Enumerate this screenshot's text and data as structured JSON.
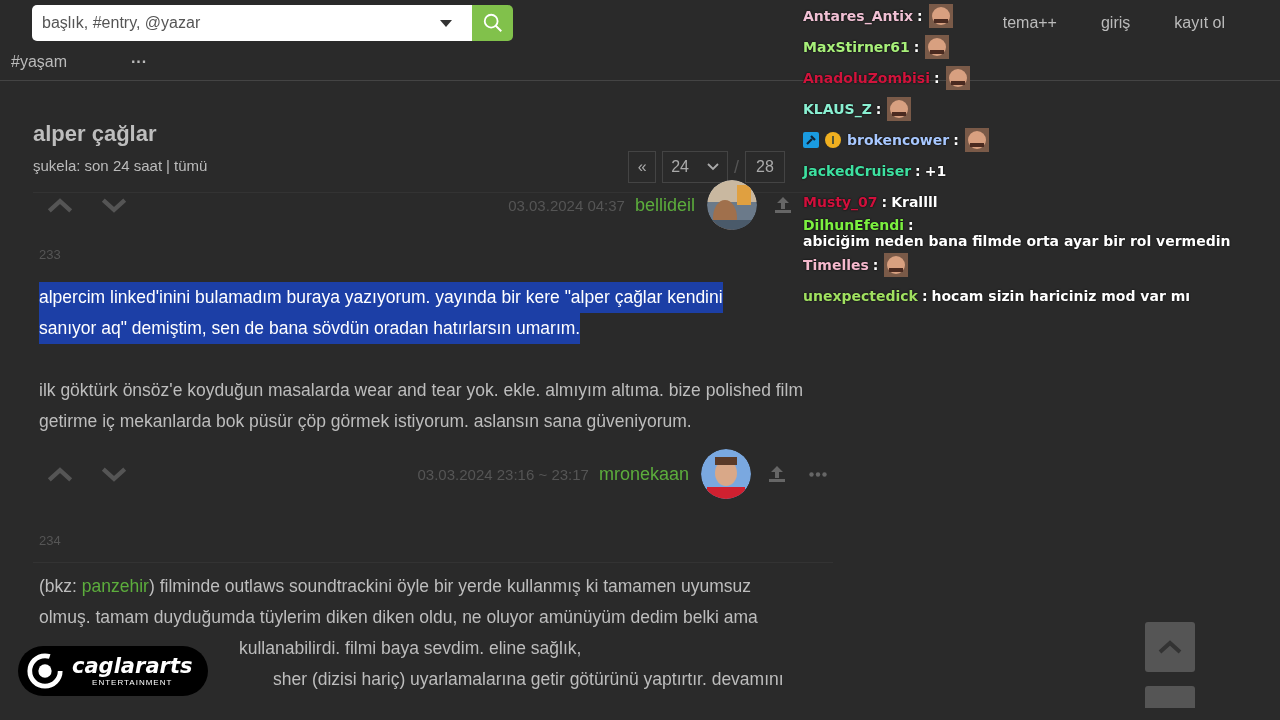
{
  "search": {
    "placeholder": "başlık, #entry, @yazar"
  },
  "nav": {
    "channels": [
      "#yaşam"
    ],
    "more": "···",
    "links": [
      "tema++",
      "giriş",
      "kayıt ol"
    ]
  },
  "topic": {
    "title": "alper çağlar",
    "filter_label": "şukela:",
    "filter_options": [
      "son 24 saat",
      "tümü"
    ],
    "filter_separator": "|"
  },
  "pagination": {
    "prev": "«",
    "page": "24",
    "separator": "/",
    "total": "28"
  },
  "prev_entry_footer": {
    "date": "03.03.2024 04:37",
    "author": "bellideil"
  },
  "entries": [
    {
      "number": "233",
      "paragraphs": [
        {
          "text": "alpercim linked'inini bulamadım buraya yazıyorum. yayında bir kere \"alper çağlar kendini",
          "selected": true
        },
        {
          "text": "sanıyor aq\" demiştim, sen de bana sövdün oradan hatırlarsın umarım.",
          "selected": true
        },
        {
          "text": "ilk göktürk önsöz'e koyduğun masalarda wear and tear yok. ekle. almıyım altıma. bize polished film getirme iç mekanlarda bok püsür çöp görmek istiyorum. aslansın sana güveniyorum.",
          "selected": false
        }
      ],
      "date": "03.03.2024 23:16 ~ 23:17",
      "author": "mronekaan"
    },
    {
      "number": "234",
      "lines": [
        {
          "bkz_prefix": "(bkz: ",
          "bkz_link": "panzehir",
          "text": ") filminde outlaws soundtrackini öyle bir yerde kullanmış ki tamamen uyumsuz"
        },
        {
          "text": "olmuş. tamam duyduğumda tüylerim diken diken oldu, ne oluyor amünüyüm dedim belki ama"
        },
        {
          "text": "kullanabilirdi. filmi baya sevdim. eline sağlık,"
        },
        {
          "text": "sher (dizisi hariç) uyarlamalarına getir götürünü yaptırtır. devamını"
        }
      ]
    }
  ],
  "chat": [
    {
      "user": "Antares_Antix",
      "color": "#f0c0d4",
      "colon": ":",
      "kind": "emote"
    },
    {
      "user": "MaxStirner61",
      "color": "#a8f07a",
      "colon": ":",
      "kind": "emote"
    },
    {
      "user": "AnadoluZombisi",
      "color": "#d0143c",
      "colon": ":",
      "kind": "emote"
    },
    {
      "user": "KLAUS_Z",
      "color": "#8af0d2",
      "colon": ":",
      "kind": "emote"
    },
    {
      "user": "brokencower",
      "color": "#a8c8ff",
      "colon": ":",
      "kind": "emote",
      "badges": true
    },
    {
      "user": "JackedCruiser",
      "color": "#3ee0a0",
      "colon": ":",
      "kind": "text",
      "message": "+1"
    },
    {
      "user": "Musty_07",
      "color": "#d0103c",
      "colon": ":",
      "kind": "text",
      "message": "Krallll"
    },
    {
      "user": "DilhunEfendi",
      "color": "#7cf040",
      "colon": ":",
      "kind": "text",
      "message": "abiciğim neden bana filmde orta ayar bir rol vermedin"
    },
    {
      "user": "Timelles",
      "color": "#f4b8cc",
      "colon": ":",
      "kind": "emote"
    },
    {
      "user": "unexpectedick",
      "color": "#a0e060",
      "colon": ":",
      "kind": "text",
      "message": "hocam sizin hariciniz mod var mı"
    }
  ],
  "logo": {
    "name": "caglararts",
    "tagline": "ENTERTAINMENT"
  }
}
